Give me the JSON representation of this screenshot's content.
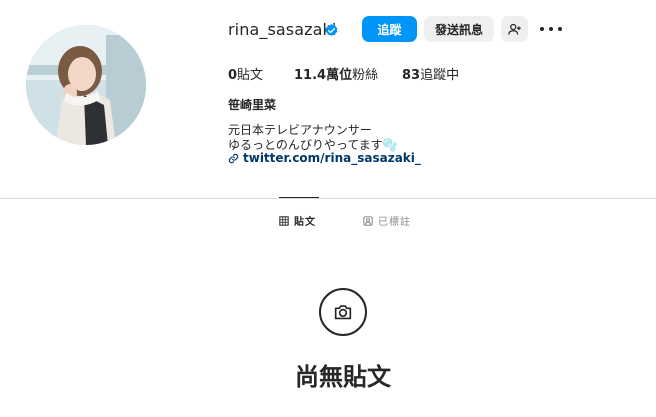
{
  "profile": {
    "username": "rina_sasazaki",
    "full_name": "笹崎里菜",
    "bio_line1": "元日本テレビアナウンサー",
    "bio_line2": "ゆるっとのんびりやってます🫧",
    "link": "twitter.com/rina_sasazaki_"
  },
  "actions": {
    "follow_label": "追蹤",
    "message_label": "發送訊息"
  },
  "stats": {
    "posts_count": "0",
    "posts_label": "貼文",
    "followers_count": "11.4萬位",
    "followers_label": "粉絲",
    "following_count": "83",
    "following_label": "追蹤中"
  },
  "tabs": [
    {
      "label": "貼文",
      "active": true,
      "icon": "grid-icon"
    },
    {
      "label": "已標註",
      "active": false,
      "icon": "tag-icon"
    }
  ],
  "empty_state": {
    "title": "尚無貼文",
    "icon": "camera-icon"
  },
  "colors": {
    "accent": "#0095f6",
    "link": "#00376b",
    "verified": "#0095f6"
  }
}
